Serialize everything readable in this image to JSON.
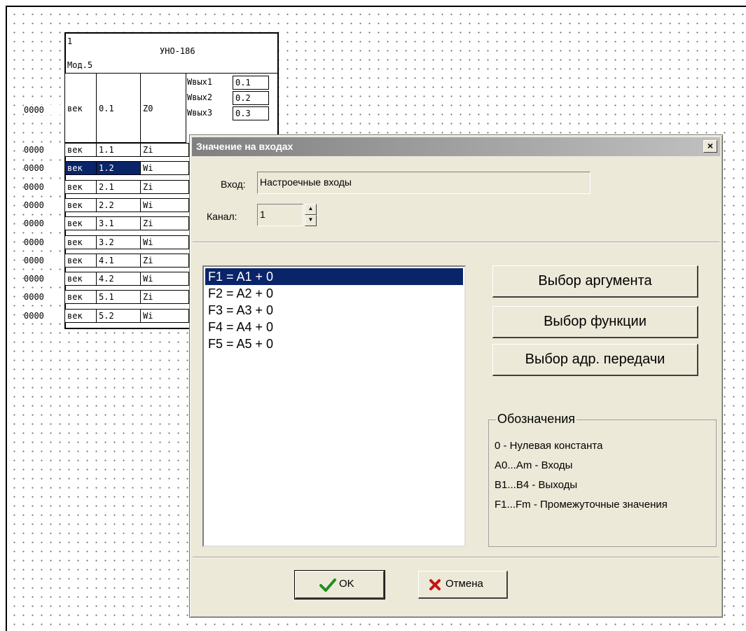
{
  "block": {
    "number": "1",
    "title": "УНО-186",
    "module": "Мод.5",
    "top_row": {
      "addr": "0000",
      "type": "век",
      "num": "0.1",
      "label": "Z0"
    },
    "outputs": [
      {
        "label": "Wвых1",
        "value": "0.1"
      },
      {
        "label": "Wвых2",
        "value": "0.2"
      },
      {
        "label": "Wвых3",
        "value": "0.3"
      }
    ],
    "rows": [
      {
        "addr": "0000",
        "type": "век",
        "num": "1.1",
        "label": "Zi"
      },
      {
        "addr": "0000",
        "type": "век",
        "num": "1.2",
        "label": "Wi"
      },
      {
        "addr": "0000",
        "type": "век",
        "num": "2.1",
        "label": "Zi"
      },
      {
        "addr": "0000",
        "type": "век",
        "num": "2.2",
        "label": "Wi"
      },
      {
        "addr": "0000",
        "type": "век",
        "num": "3.1",
        "label": "Zi"
      },
      {
        "addr": "0000",
        "type": "век",
        "num": "3.2",
        "label": "Wi"
      },
      {
        "addr": "0000",
        "type": "век",
        "num": "4.1",
        "label": "Zi"
      },
      {
        "addr": "0000",
        "type": "век",
        "num": "4.2",
        "label": "Wi"
      },
      {
        "addr": "0000",
        "type": "век",
        "num": "5.1",
        "label": "Zi"
      },
      {
        "addr": "0000",
        "type": "век",
        "num": "5.2",
        "label": "Wi"
      }
    ]
  },
  "dialog": {
    "title": "Значение на входах",
    "close_glyph": "×",
    "input_label": "Вход:",
    "input_value": "Настроечные входы",
    "channel_label": "Канал:",
    "channel_value": "1",
    "spin_up": "▲",
    "spin_down": "▼",
    "functions": [
      "F1 = A1 + 0",
      "F2 = A2 + 0",
      "F3 = A3 + 0",
      "F4 = A4 + 0",
      "F5 = A5 + 0"
    ],
    "buttons": {
      "arg": "Выбор аргумента",
      "func": "Выбор функции",
      "addr": "Выбор адр. передачи",
      "ok": "OK",
      "cancel": "Отмена"
    },
    "legend": {
      "title": "Обозначения",
      "lines": [
        "0  -  Нулевая константа",
        "A0...Am  -  Входы",
        "B1...B4  -  Выходы",
        "F1...Fm - Промежуточные значения"
      ]
    }
  }
}
